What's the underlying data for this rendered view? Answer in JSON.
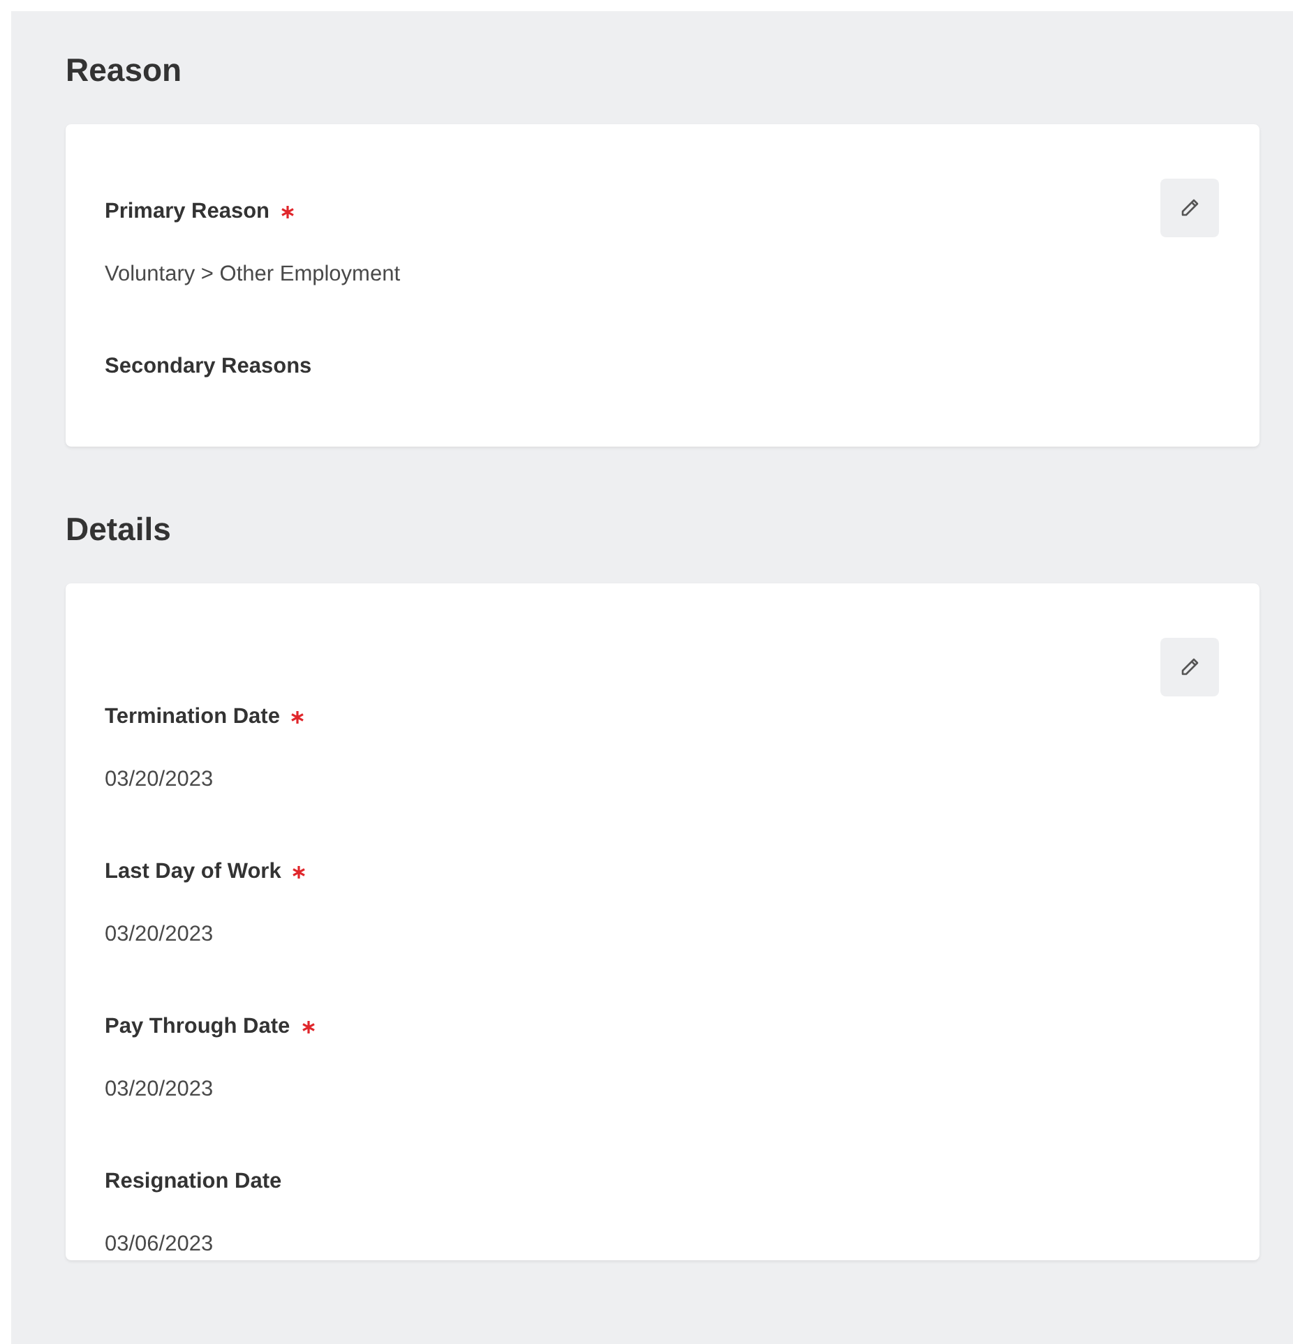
{
  "sections": [
    {
      "title": "Reason",
      "fields": [
        {
          "label": "Primary Reason",
          "required": true,
          "value": "Voluntary > Other Employment"
        },
        {
          "label": "Secondary Reasons",
          "required": false
        }
      ]
    },
    {
      "title": "Details",
      "fields": [
        {
          "label": "Termination Date",
          "required": true,
          "value": "03/20/2023"
        },
        {
          "label": "Last Day of Work",
          "required": true,
          "value": "03/20/2023"
        },
        {
          "label": "Pay Through Date",
          "required": true,
          "value": "03/20/2023"
        },
        {
          "label": "Resignation Date",
          "required": false,
          "value": "03/06/2023"
        }
      ]
    }
  ]
}
